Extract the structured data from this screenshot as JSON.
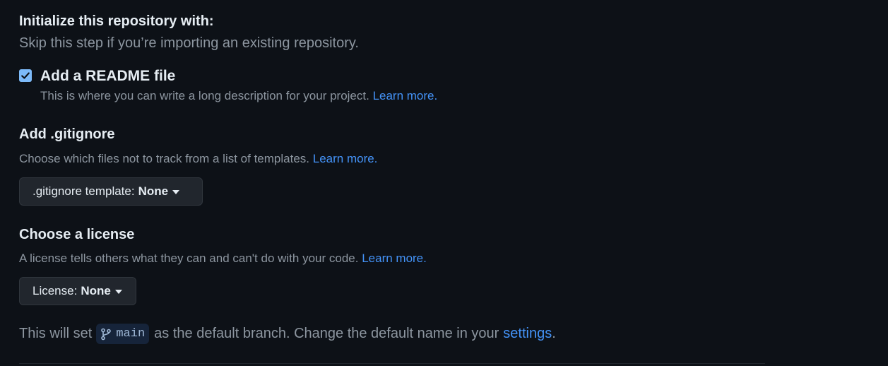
{
  "init": {
    "title": "Initialize this repository with:",
    "subtitle": "Skip this step if you’re importing an existing repository."
  },
  "readme": {
    "checked": true,
    "label": "Add a README file",
    "description": "This is where you can write a long description for your project.",
    "learn_more": "Learn more."
  },
  "gitignore": {
    "title": "Add .gitignore",
    "description": "Choose which files not to track from a list of templates.",
    "learn_more": "Learn more.",
    "dropdown_label": ".gitignore template:",
    "dropdown_value": "None"
  },
  "license": {
    "title": "Choose a license",
    "description": "A license tells others what they can and can't do with your code.",
    "learn_more": "Learn more.",
    "dropdown_label": "License:",
    "dropdown_value": "None"
  },
  "branch": {
    "prefix": "This will set",
    "name": "main",
    "middle": "as the default branch. Change the default name in your",
    "settings_link": "settings",
    "suffix": "."
  },
  "colors": {
    "background": "#0d1117",
    "text": "#e6edf3",
    "muted": "#8d96a0",
    "link": "#4493f8",
    "checkbox": "#7dbaf9"
  }
}
